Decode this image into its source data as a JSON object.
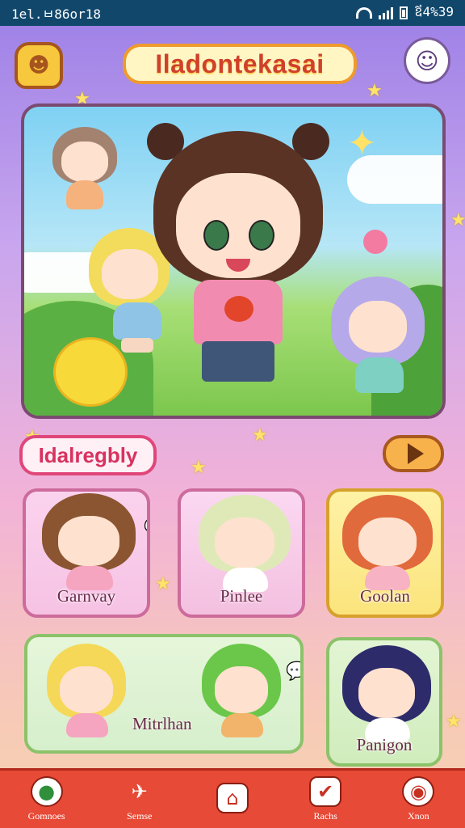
{
  "status_bar": {
    "time": "1el.ㅂ86or18",
    "right": "ឪ4%39"
  },
  "header": {
    "title": "Iladontekasai"
  },
  "section": {
    "title": "Idalregbly"
  },
  "cards": [
    {
      "label": "Garnvay"
    },
    {
      "label": "Pinlee"
    },
    {
      "label": "Goolan"
    },
    {
      "label": "Mitrlhan"
    },
    {
      "label": "Panigon"
    }
  ],
  "nav": [
    {
      "label": "Gomnoes",
      "icon": "game-controller-icon"
    },
    {
      "label": "Semse",
      "icon": "plane-icon"
    },
    {
      "label": "",
      "icon": "house-icon"
    },
    {
      "label": "Rachs",
      "icon": "checkbox-icon"
    },
    {
      "label": "Xnon",
      "icon": "profile-icon"
    }
  ],
  "colors": {
    "status": "#10476b",
    "nav": "#e74a36",
    "title_text": "#d0402a",
    "section_text": "#d8325f"
  }
}
